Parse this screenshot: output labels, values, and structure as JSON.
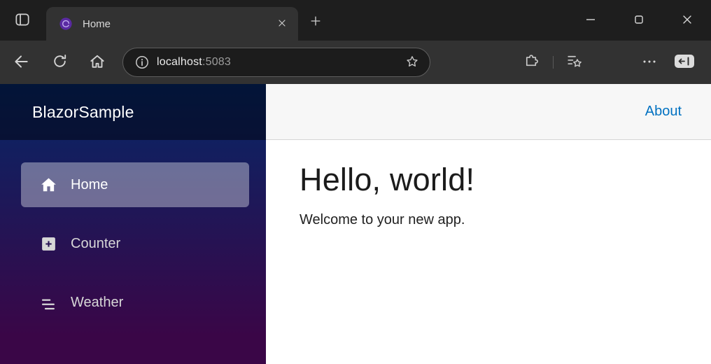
{
  "browser": {
    "tab_title": "Home",
    "url_host": "localhost",
    "url_port": ":5083"
  },
  "app": {
    "brand": "BlazorSample",
    "nav": [
      {
        "label": "Home",
        "active": true
      },
      {
        "label": "Counter",
        "active": false
      },
      {
        "label": "Weather",
        "active": false
      }
    ],
    "about_label": "About",
    "heading": "Hello, world!",
    "welcome": "Welcome to your new app."
  },
  "colors": {
    "tabstrip_bg": "#1e1e1e",
    "toolbar_bg": "#323232",
    "addressbar_bg": "#1c1c1c",
    "sidebar_gradient_top": "#052767",
    "sidebar_gradient_bottom": "#3a0647",
    "active_nav_bg": "rgba(255,255,255,0.37)",
    "link_blue": "#0071c1",
    "topbar_bg": "#f7f7f7",
    "favicon_purple": "#5a2aa2"
  },
  "icons": {
    "tab_actions": "tab-actions-icon",
    "favicon": "blazor-logo-icon",
    "tab_close": "close-icon",
    "new_tab": "plus-icon",
    "minimize": "minimize-icon",
    "maximize": "maximize-icon",
    "close_window": "close-icon",
    "back": "back-arrow-icon",
    "refresh": "refresh-icon",
    "browser_home": "home-icon",
    "site_info": "info-icon",
    "favorite_star": "star-icon",
    "extensions": "puzzle-icon",
    "favorites_hub": "favorites-list-star-icon",
    "menu": "ellipsis-icon",
    "sidebar_toggle": "sidebar-panel-icon",
    "nav_home": "house-icon",
    "nav_counter": "plus-square-icon",
    "nav_weather": "list-icon"
  }
}
